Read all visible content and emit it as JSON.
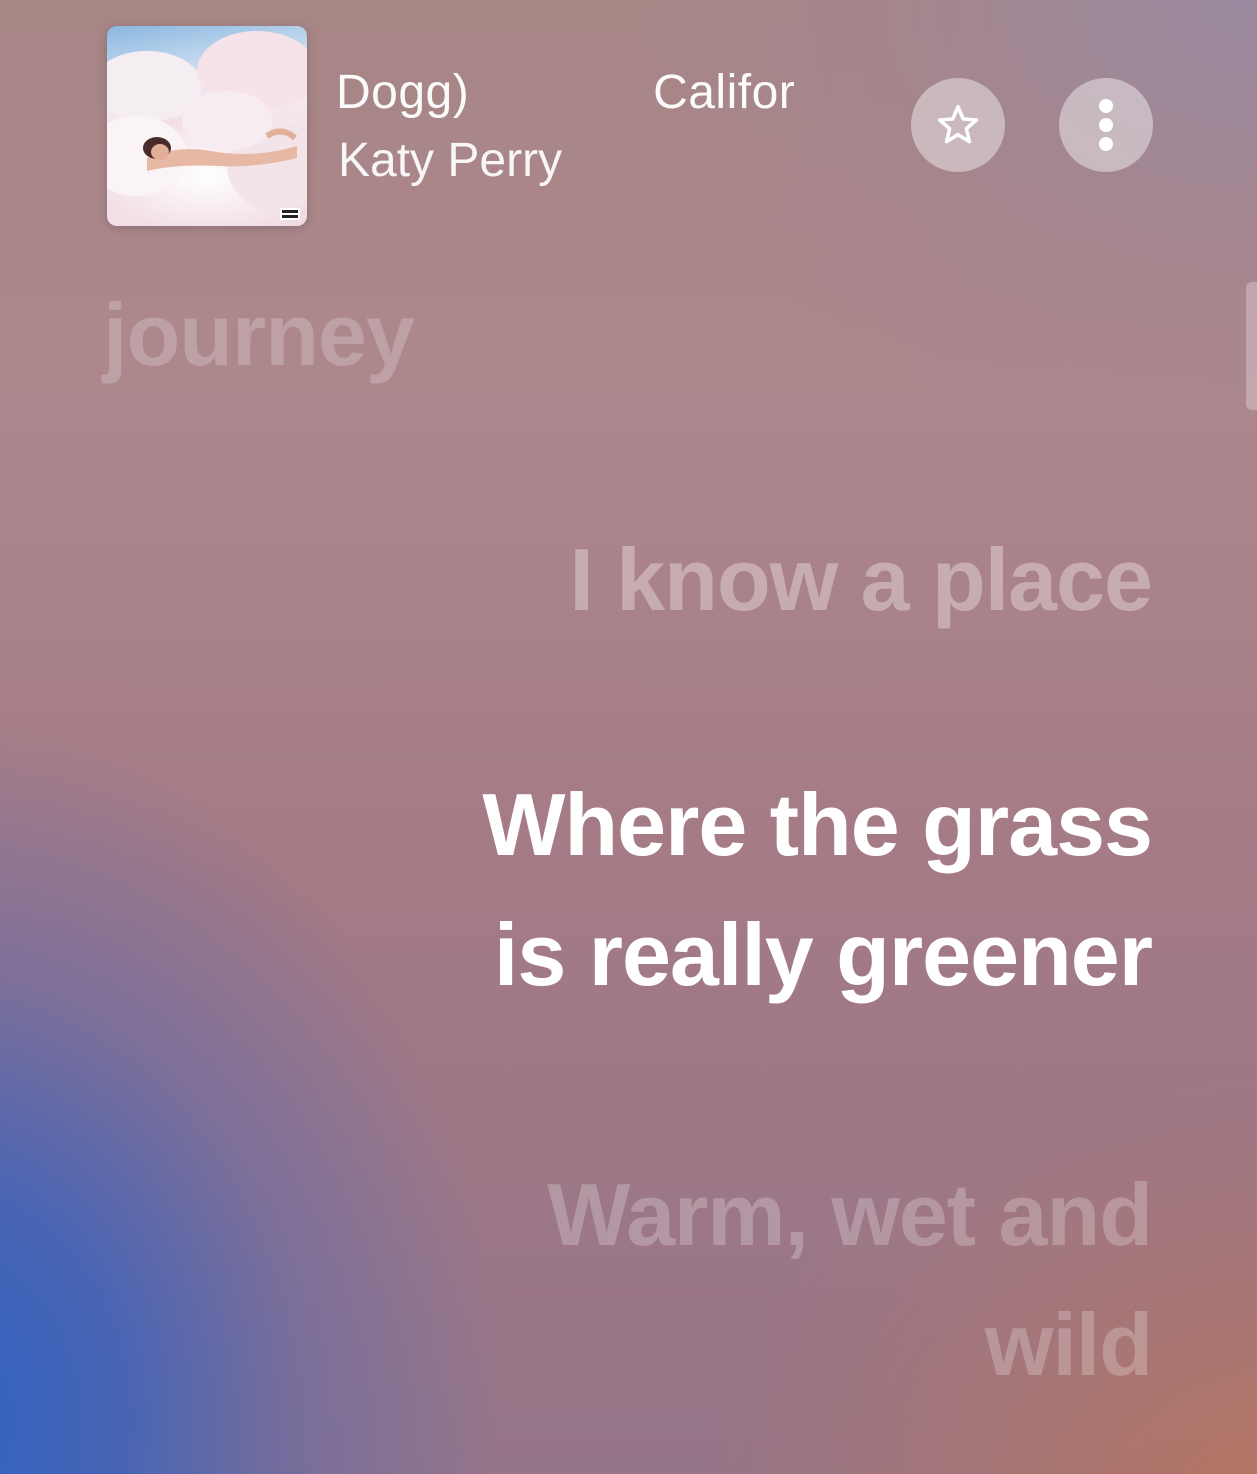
{
  "now_playing": {
    "title_marquee": "Dogg) Califor",
    "artist": "Katy Perry",
    "album_art": "album-cover-art",
    "explicit_badge": "PARENTAL ADVISORY EXPLICIT CONTENT"
  },
  "controls": {
    "favorite_icon": "star-outline-icon",
    "more_icon": "more-vertical-icon"
  },
  "lyrics": {
    "previous": "journey",
    "upcoming": "I know a place",
    "active_line_1": "Where the grass",
    "active_line_2": "is really greener",
    "next_line_1": "Warm, wet and",
    "next_line_2": "wild"
  },
  "colors": {
    "background_top": "#a78686",
    "background_blue": "#2f63c4",
    "background_orange": "#b9755f",
    "active_lyric": "#ffffff"
  }
}
